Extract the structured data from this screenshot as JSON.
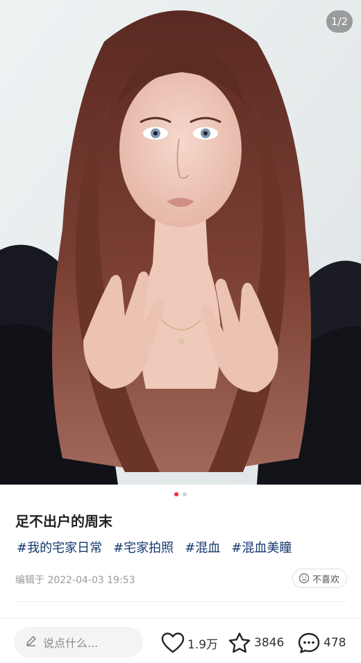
{
  "photo": {
    "description_icon": "portrait-photo",
    "counter": "1/2",
    "page_index": 1,
    "page_total": 2
  },
  "pager": {
    "active_index": 0,
    "count": 2,
    "active_color": "#ff2442"
  },
  "post": {
    "title": "足不出户的周末",
    "tags": [
      "#我的宅家日常",
      "#宅家拍照",
      "#混血",
      "#混血美瞳"
    ],
    "edited": "编辑于 2022-04-03 19:53",
    "dislike_label": "不喜欢"
  },
  "bottom_bar": {
    "comment_placeholder": "说点什么...",
    "likes": "1.9万",
    "collects": "3846",
    "comments": "478"
  },
  "colors": {
    "tag": "#13386c",
    "accent": "#ff2442"
  }
}
